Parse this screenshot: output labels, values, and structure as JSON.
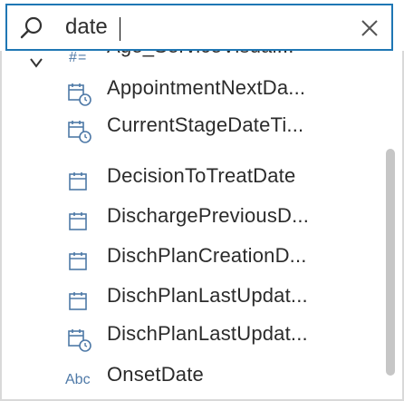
{
  "search": {
    "value": "date",
    "placeholder": ""
  },
  "colors": {
    "accent": "#1f77b4",
    "icon": "#4e79a7"
  },
  "group": {
    "expanded_glyph": "chevron-down"
  },
  "fields": [
    {
      "label": "Age_ServiceVisual...",
      "icon": "calc-number-icon"
    },
    {
      "label": "AppointmentNextDa...",
      "icon": "calc-date-icon"
    },
    {
      "label": "CurrentStageDateTi...",
      "icon": "calc-date-icon"
    },
    {
      "label": "DecisionToTreatDate",
      "icon": "calendar-icon"
    },
    {
      "label": "DischargePreviousD...",
      "icon": "calendar-icon"
    },
    {
      "label": "DischPlanCreationD...",
      "icon": "calendar-icon"
    },
    {
      "label": "DischPlanLastUpdat...",
      "icon": "calendar-icon"
    },
    {
      "label": "DischPlanLastUpdat...",
      "icon": "calc-date-icon"
    },
    {
      "label": "OnsetDate",
      "icon": "abc-icon",
      "icon_text": "Abc"
    }
  ]
}
